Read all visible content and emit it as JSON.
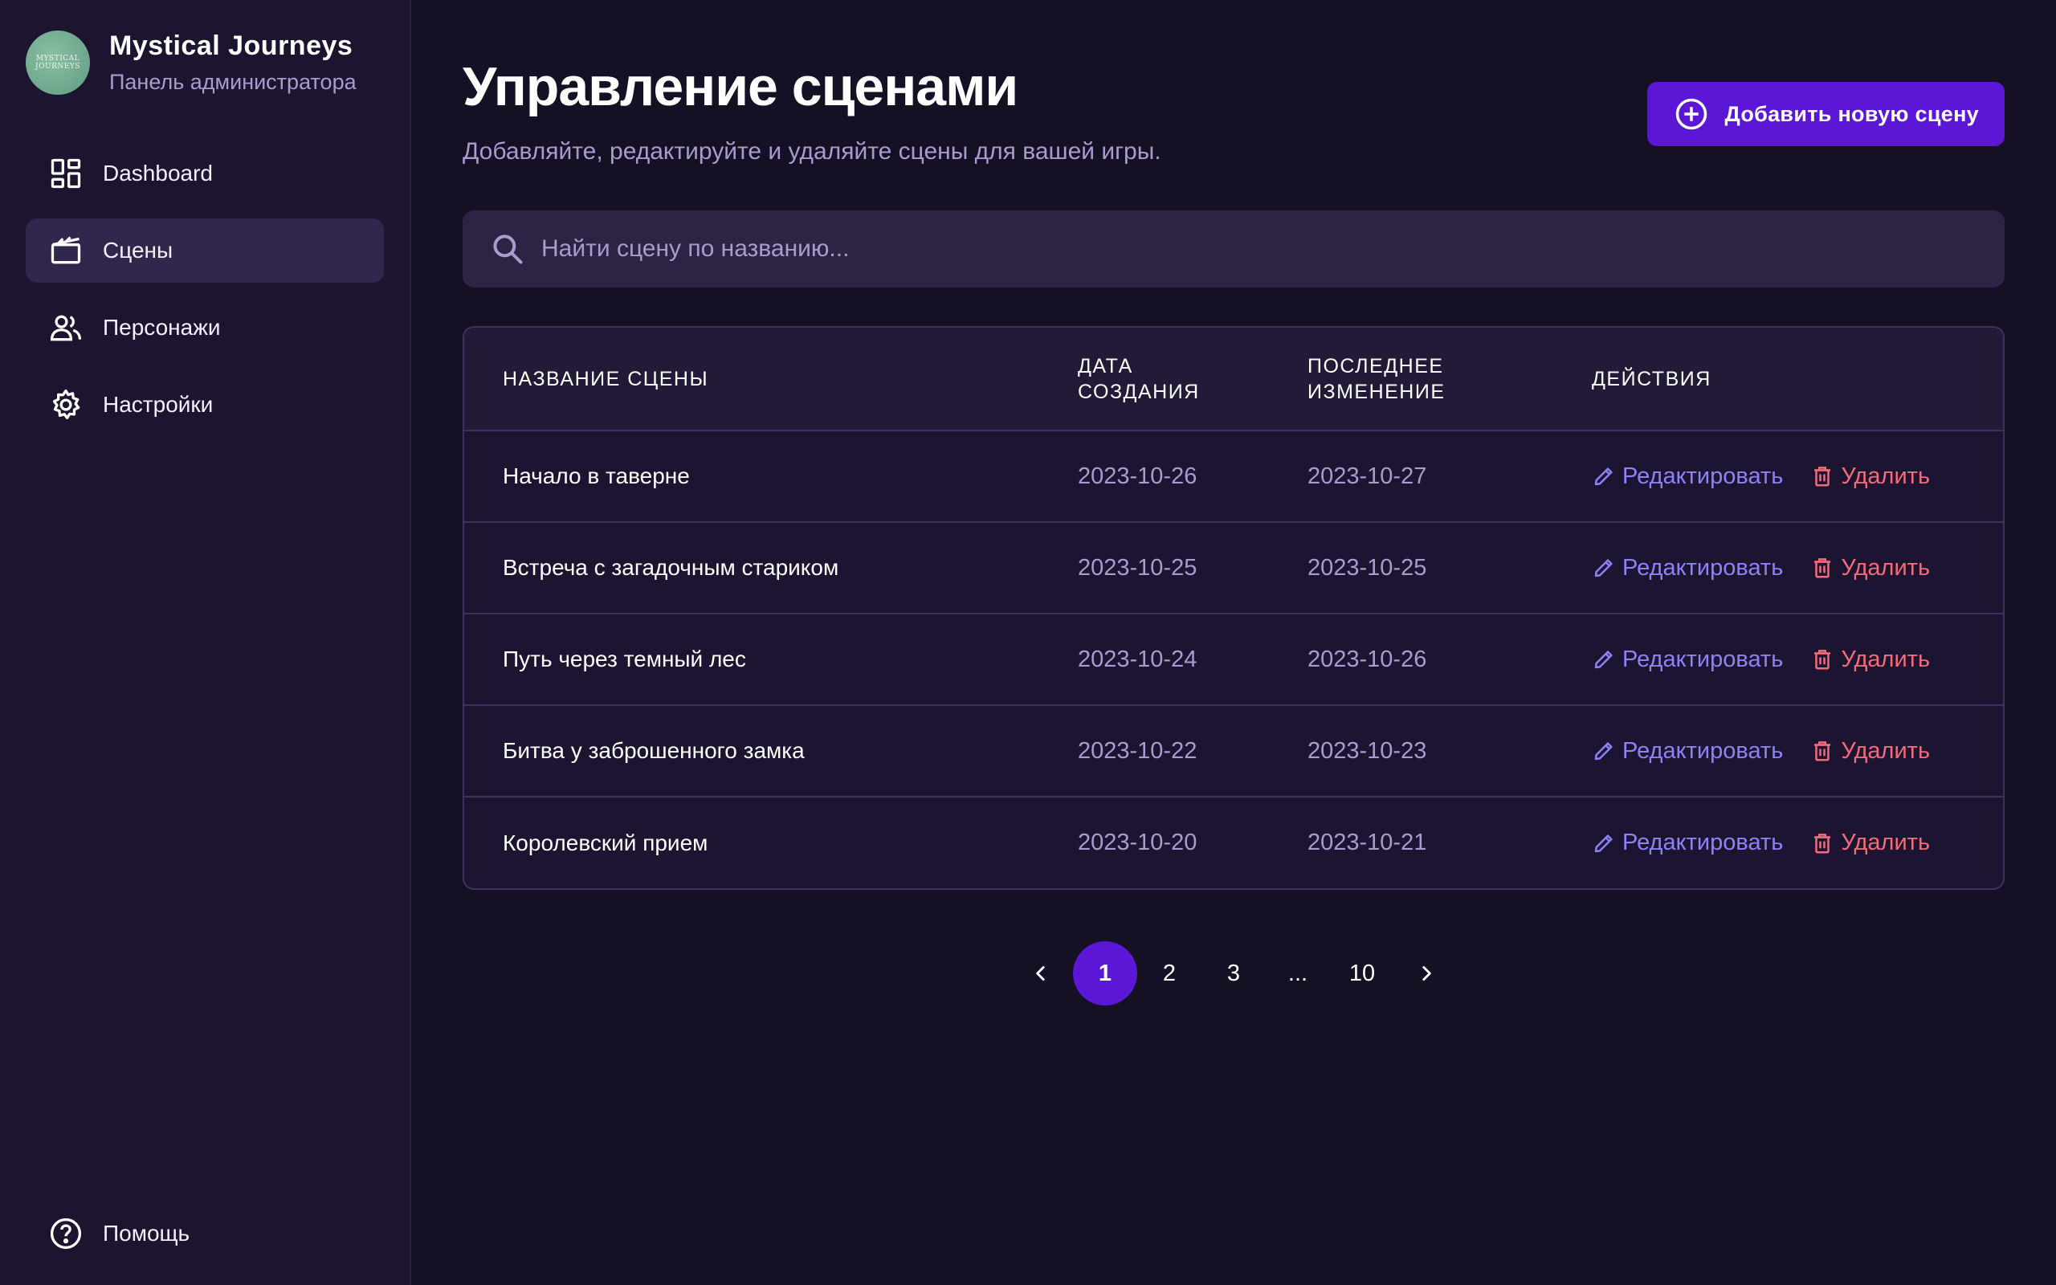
{
  "brand": {
    "name": "Mystical Journeys",
    "subtitle": "Панель администратора",
    "logo_text": "MYSTICAL JOURNEYS"
  },
  "nav": {
    "items": [
      {
        "label": "Dashboard",
        "icon": "dashboard-icon"
      },
      {
        "label": "Сцены",
        "icon": "clapperboard-icon",
        "active": true
      },
      {
        "label": "Персонажи",
        "icon": "users-icon"
      },
      {
        "label": "Настройки",
        "icon": "gear-icon"
      }
    ],
    "help": {
      "label": "Помощь",
      "icon": "help-circle-icon"
    }
  },
  "header": {
    "title": "Управление сценами",
    "subtitle": "Добавляйте, редактируйте и удаляйте сцены для вашей игры.",
    "add_button": "Добавить новую сцену"
  },
  "search": {
    "placeholder": "Найти сцену по названию..."
  },
  "table": {
    "headers": {
      "name": "НАЗВАНИЕ СЦЕНЫ",
      "created": "ДАТА СОЗДАНИЯ",
      "updated": "ПОСЛЕДНЕЕ ИЗМЕНЕНИЕ",
      "actions": "ДЕЙСТВИЯ"
    },
    "edit_label": "Редактировать",
    "delete_label": "Удалить",
    "rows": [
      {
        "name": "Начало в таверне",
        "created": "2023-10-26",
        "updated": "2023-10-27"
      },
      {
        "name": "Встреча с загадочным стариком",
        "created": "2023-10-25",
        "updated": "2023-10-25"
      },
      {
        "name": "Путь через темный лес",
        "created": "2023-10-24",
        "updated": "2023-10-26"
      },
      {
        "name": "Битва у заброшенного замка",
        "created": "2023-10-22",
        "updated": "2023-10-23"
      },
      {
        "name": "Королевский прием",
        "created": "2023-10-20",
        "updated": "2023-10-21"
      }
    ]
  },
  "pagination": {
    "pages": [
      "1",
      "2",
      "3",
      "...",
      "10"
    ],
    "current": "1"
  },
  "colors": {
    "accent": "#5b16d6",
    "edit": "#8c82f5",
    "delete": "#f26b7a",
    "muted": "#a89bd0"
  }
}
